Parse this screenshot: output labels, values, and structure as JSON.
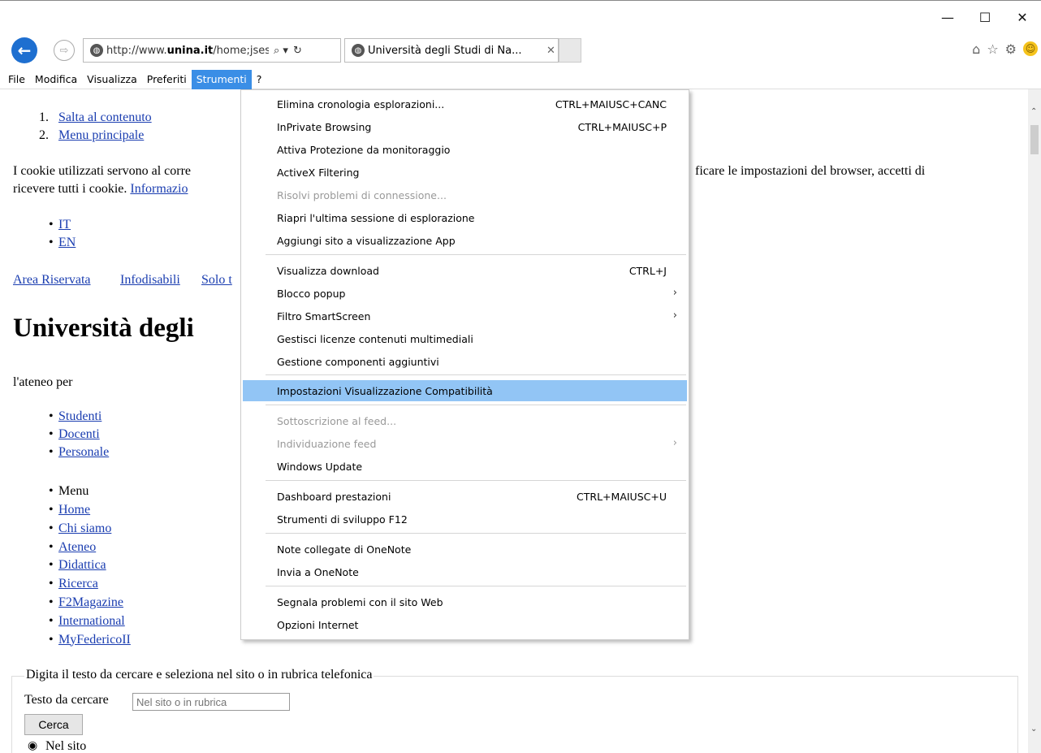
{
  "window": {
    "minimize": "—",
    "maximize": "☐",
    "close": "✕"
  },
  "nav": {
    "back": "←",
    "forward": "⇨"
  },
  "address": {
    "url_prefix": "http://www.",
    "url_domain": "unina.it",
    "url_suffix": "/home;jsess",
    "search_glyph": "⌕ ▾",
    "refresh_glyph": "↻"
  },
  "tab": {
    "title": "Università degli Studi di Na...",
    "close": "✕"
  },
  "toolbar_icons": {
    "home": "⌂",
    "favorites": "☆",
    "settings": "⚙",
    "feedback": "☺"
  },
  "menubar": {
    "file": "File",
    "edit": "Modifica",
    "view": "Visualizza",
    "favorites": "Preferiti",
    "tools": "Strumenti",
    "help": "?"
  },
  "page": {
    "skip_links": [
      "1.",
      "Salta al contenuto",
      "2.",
      "Menu principale"
    ],
    "cookie_start": "I cookie utilizzati servono al corre",
    "cookie_end": "ficare le impostazioni del browser, accetti di",
    "cookie_line2": "ricevere tutti i cookie. ",
    "cookie_link": "Informazio",
    "langs": [
      "IT",
      "EN"
    ],
    "top_links": [
      "Area Riservata",
      "Infodisabili",
      "Solo t"
    ],
    "heading": "Università degli",
    "ateneo_per": "l'ateneo per",
    "audience": [
      "Studenti",
      "Docenti",
      "Personale"
    ],
    "menu_label": "Menu",
    "menu_items": [
      "Home",
      "Chi siamo",
      "Ateneo",
      "Didattica",
      "Ricerca",
      "F2Magazine",
      "International",
      "MyFedericoII"
    ],
    "search_legend": "Digita il testo da cercare e seleziona nel sito o in rubrica telefonica",
    "search_label": "Testo da cercare",
    "search_placeholder": "Nel sito o in rubrica",
    "search_button": "Cerca",
    "radio_label": "Nel sito"
  },
  "tools_menu": {
    "items": [
      {
        "label": "Elimina cronologia esplorazioni...",
        "shortcut": "CTRL+MAIUSC+CANC"
      },
      {
        "label": "InPrivate Browsing",
        "shortcut": "CTRL+MAIUSC+P"
      },
      {
        "label": "Attiva Protezione da monitoraggio",
        "shortcut": ""
      },
      {
        "label": "ActiveX Filtering",
        "shortcut": ""
      },
      {
        "label": "Risolvi problemi di connessione...",
        "shortcut": "",
        "disabled": true
      },
      {
        "label": "Riapri l'ultima sessione di esplorazione",
        "shortcut": ""
      },
      {
        "label": "Aggiungi sito a visualizzazione App",
        "shortcut": ""
      },
      {
        "label": "Visualizza download",
        "shortcut": "CTRL+J"
      },
      {
        "label": "Blocco popup",
        "shortcut": "",
        "submenu": true
      },
      {
        "label": "Filtro SmartScreen",
        "shortcut": "",
        "submenu": true
      },
      {
        "label": "Gestisci licenze contenuti multimediali",
        "shortcut": ""
      },
      {
        "label": "Gestione componenti aggiuntivi",
        "shortcut": ""
      },
      {
        "label": "Impostazioni Visualizzazione Compatibilità",
        "shortcut": "",
        "highlighted": true
      },
      {
        "label": "Sottoscrizione al feed...",
        "shortcut": "",
        "disabled": true
      },
      {
        "label": "Individuazione feed",
        "shortcut": "",
        "disabled": true,
        "submenu": true
      },
      {
        "label": "Windows Update",
        "shortcut": ""
      },
      {
        "label": "Dashboard prestazioni",
        "shortcut": "CTRL+MAIUSC+U"
      },
      {
        "label": "Strumenti di sviluppo F12",
        "shortcut": ""
      },
      {
        "label": "Note collegate di OneNote",
        "shortcut": ""
      },
      {
        "label": "Invia a OneNote",
        "shortcut": ""
      },
      {
        "label": "Segnala problemi con il sito Web",
        "shortcut": ""
      },
      {
        "label": "Opzioni Internet",
        "shortcut": ""
      }
    ],
    "submenu_glyph": "›"
  },
  "colors": {
    "menu_active": "#3a8ee6",
    "menu_highlight": "#92c5f5",
    "link": "#1a3db0",
    "back_button": "#1e6fd0"
  }
}
